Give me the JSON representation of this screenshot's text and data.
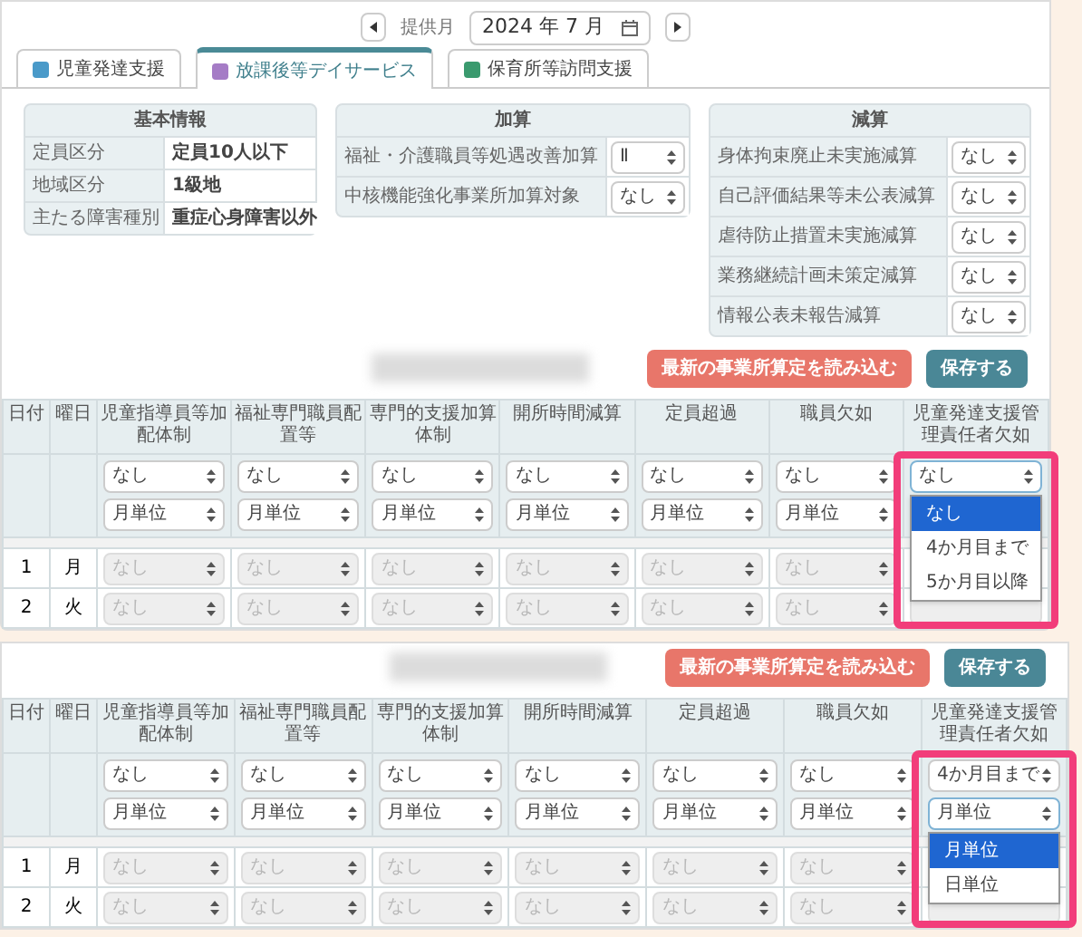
{
  "month_picker": {
    "label": "提供月",
    "value": "2024 年 7 月"
  },
  "tabs": [
    {
      "label": "児童発達支援",
      "color": "#4a9ac9",
      "selected": false
    },
    {
      "label": "放課後等デイサービス",
      "color": "#a57cc6",
      "selected": true
    },
    {
      "label": "保育所等訪問支援",
      "color": "#3a9a6e",
      "selected": false
    }
  ],
  "basic_info": {
    "title": "基本情報",
    "rows": [
      {
        "label": "定員区分",
        "value": "定員10人以下"
      },
      {
        "label": "地域区分",
        "value": "1級地"
      },
      {
        "label": "主たる障害種別",
        "value": "重症心身障害以外"
      }
    ]
  },
  "additions": {
    "title": "加算",
    "rows": [
      {
        "label": "福祉・介護職員等処遇改善加算",
        "value": "Ⅱ"
      },
      {
        "label": "中核機能強化事業所加算対象",
        "value": "なし"
      }
    ]
  },
  "deductions": {
    "title": "減算",
    "rows": [
      {
        "label": "身体拘束廃止未実施減算",
        "value": "なし"
      },
      {
        "label": "自己評価結果等未公表減算",
        "value": "なし"
      },
      {
        "label": "虐待防止措置未実施減算",
        "value": "なし"
      },
      {
        "label": "業務継続計画未策定減算",
        "value": "なし"
      },
      {
        "label": "情報公表未報告減算",
        "value": "なし"
      }
    ]
  },
  "views": [
    {
      "highlight": true,
      "load_button": "最新の事業所算定を読み込む",
      "save_button": "保存する",
      "columns": [
        "日付",
        "曜日",
        "児童指導員等加配体制",
        "福祉専門職員配置等",
        "専門的支援加算体制",
        "開所時間減算",
        "定員超過",
        "職員欠如",
        "児童発達支援管理責任者欠如"
      ],
      "settings": [
        {
          "selects": [
            {
              "value": "なし",
              "open": false
            },
            {
              "value": "月単位",
              "open": false
            }
          ]
        },
        {
          "selects": [
            {
              "value": "なし",
              "open": false
            },
            {
              "value": "月単位",
              "open": false
            }
          ]
        },
        {
          "selects": [
            {
              "value": "なし",
              "open": false
            },
            {
              "value": "月単位",
              "open": false
            }
          ]
        },
        {
          "selects": [
            {
              "value": "なし",
              "open": false
            },
            {
              "value": "月単位",
              "open": false
            }
          ]
        },
        {
          "selects": [
            {
              "value": "なし",
              "open": false
            },
            {
              "value": "月単位",
              "open": false
            }
          ]
        },
        {
          "selects": [
            {
              "value": "なし",
              "open": false
            },
            {
              "value": "月単位",
              "open": false
            }
          ]
        },
        {
          "selects": [
            {
              "value": "なし",
              "open": true,
              "options": [
                {
                  "label": "なし",
                  "selected": true
                },
                {
                  "label": "4か月目まで",
                  "selected": false
                },
                {
                  "label": "5か月目以降",
                  "selected": false
                }
              ]
            }
          ]
        }
      ],
      "days": [
        {
          "date": "1",
          "weekday": "月",
          "values": [
            "なし",
            "なし",
            "なし",
            "なし",
            "なし",
            "なし"
          ]
        },
        {
          "date": "2",
          "weekday": "火",
          "values": [
            "なし",
            "なし",
            "なし",
            "なし",
            "なし",
            "なし"
          ]
        }
      ]
    },
    {
      "highlight": true,
      "load_button": "最新の事業所算定を読み込む",
      "save_button": "保存する",
      "columns": [
        "日付",
        "曜日",
        "児童指導員等加配体制",
        "福祉専門職員配置等",
        "専門的支援加算体制",
        "開所時間減算",
        "定員超過",
        "職員欠如",
        "児童発達支援管理責任者欠如"
      ],
      "settings": [
        {
          "selects": [
            {
              "value": "なし",
              "open": false
            },
            {
              "value": "月単位",
              "open": false
            }
          ]
        },
        {
          "selects": [
            {
              "value": "なし",
              "open": false
            },
            {
              "value": "月単位",
              "open": false
            }
          ]
        },
        {
          "selects": [
            {
              "value": "なし",
              "open": false
            },
            {
              "value": "月単位",
              "open": false
            }
          ]
        },
        {
          "selects": [
            {
              "value": "なし",
              "open": false
            },
            {
              "value": "月単位",
              "open": false
            }
          ]
        },
        {
          "selects": [
            {
              "value": "なし",
              "open": false
            },
            {
              "value": "月単位",
              "open": false
            }
          ]
        },
        {
          "selects": [
            {
              "value": "なし",
              "open": false
            },
            {
              "value": "月単位",
              "open": false
            }
          ]
        },
        {
          "selects": [
            {
              "value": "4か月目まで",
              "open": false
            },
            {
              "value": "月単位",
              "open": true,
              "options": [
                {
                  "label": "月単位",
                  "selected": true
                },
                {
                  "label": "日単位",
                  "selected": false
                }
              ]
            }
          ]
        }
      ],
      "days": [
        {
          "date": "1",
          "weekday": "月",
          "values": [
            "なし",
            "なし",
            "なし",
            "なし",
            "なし",
            "なし"
          ]
        },
        {
          "date": "2",
          "weekday": "火",
          "values": [
            "なし",
            "なし",
            "なし",
            "なし",
            "なし",
            "なし"
          ]
        }
      ]
    }
  ]
}
